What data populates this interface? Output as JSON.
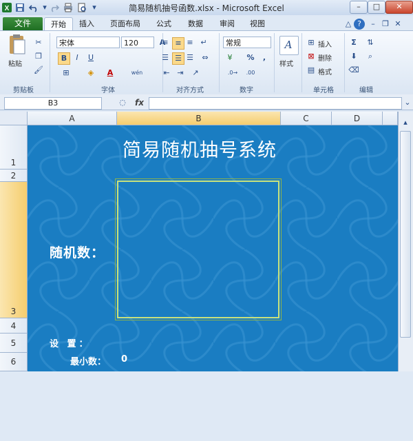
{
  "window": {
    "title": "简易随机抽号函数.xlsx - Microsoft Excel",
    "controls": [
      "–",
      "□",
      "✕"
    ]
  },
  "quick_access": {
    "icons": [
      "excel-icon",
      "save-icon",
      "undo-icon",
      "redo-icon",
      "print-icon",
      "print-preview-icon"
    ]
  },
  "tabs": {
    "file": "文件",
    "items": [
      "开始",
      "插入",
      "页面布局",
      "公式",
      "数据",
      "审阅",
      "视图"
    ],
    "active": "开始"
  },
  "ribbon": {
    "clipboard": {
      "label": "剪贴板",
      "paste": "粘贴"
    },
    "font": {
      "label": "字体",
      "name": "宋体",
      "size": "120",
      "bold": "B",
      "italic": "I",
      "underline": "U",
      "wen": "wén",
      "a_grow": "A",
      "a_shrink": "A"
    },
    "alignment": {
      "label": "对齐方式"
    },
    "number": {
      "label": "数字",
      "format": "常规",
      "percent": "%",
      "comma": ","
    },
    "styles": {
      "label": "样式"
    },
    "cells": {
      "label": "单元格",
      "insert": "插入",
      "delete": "删除",
      "format": "格式"
    },
    "editing": {
      "label": "编辑",
      "sigma": "Σ"
    }
  },
  "formula_bar": {
    "name_box": "B3",
    "fx": "fx",
    "formula": ""
  },
  "grid": {
    "columns": [
      "A",
      "B",
      "C",
      "D"
    ],
    "rows": [
      "1",
      "2",
      "3",
      "4",
      "5",
      "6"
    ]
  },
  "sheet": {
    "title": "简易随机抽号系统",
    "random_label": "随机数：",
    "settings_label": "设 置：",
    "min_label": "最小数：",
    "min_value": "0",
    "background_color": "#1a7dc2",
    "frame_color": "#c9e27b"
  }
}
